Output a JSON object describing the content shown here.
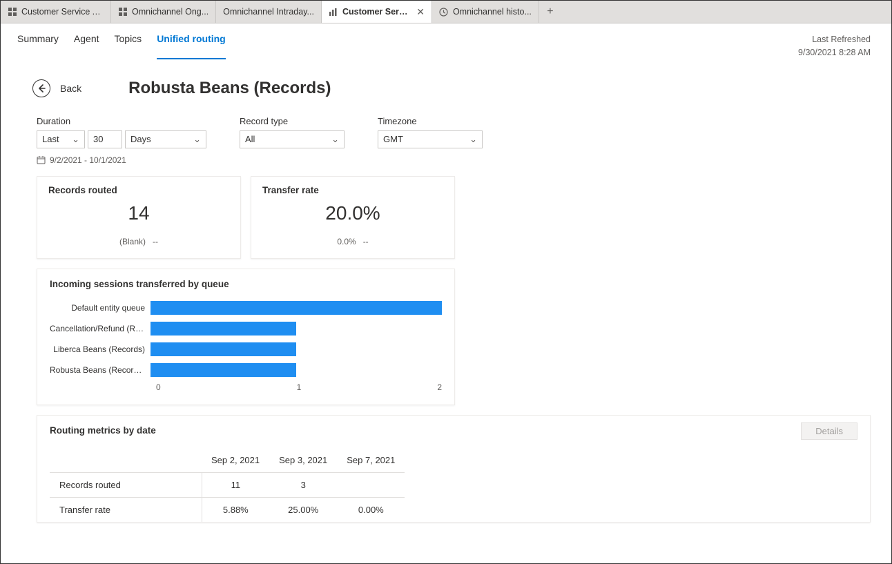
{
  "tabs": [
    {
      "label": "Customer Service A...",
      "active": false,
      "closable": false,
      "icon": "grid"
    },
    {
      "label": "Omnichannel Ong...",
      "active": false,
      "closable": false,
      "icon": "grid"
    },
    {
      "label": "Omnichannel Intraday...",
      "active": false,
      "closable": false,
      "icon": "none"
    },
    {
      "label": "Customer Service historic...",
      "active": true,
      "closable": true,
      "icon": "report"
    },
    {
      "label": "Omnichannel histo...",
      "active": false,
      "closable": false,
      "icon": "clock"
    }
  ],
  "subnav": {
    "items": [
      "Summary",
      "Agent",
      "Topics",
      "Unified routing"
    ],
    "active_index": 3
  },
  "refresh": {
    "label": "Last Refreshed",
    "value": "9/30/2021 8:28 AM"
  },
  "back_label": "Back",
  "page_title": "Robusta Beans (Records)",
  "filters": {
    "duration": {
      "label": "Duration",
      "last": "Last",
      "num": "30",
      "unit": "Days"
    },
    "record_type": {
      "label": "Record type",
      "value": "All"
    },
    "timezone": {
      "label": "Timezone",
      "value": "GMT"
    },
    "date_range": "9/2/2021 - 10/1/2021"
  },
  "kpi": {
    "records_routed": {
      "title": "Records routed",
      "value": "14",
      "sub_label": "(Blank)",
      "sub_value": "--"
    },
    "transfer_rate": {
      "title": "Transfer rate",
      "value": "20.0%",
      "sub_label": "0.0%",
      "sub_value": "--"
    }
  },
  "chart_data": {
    "type": "bar",
    "title": "Incoming sessions transferred by queue",
    "orientation": "horizontal",
    "categories": [
      "Default entity queue",
      "Cancellation/Refund (Rec...",
      "Liberca Beans (Records)",
      "Robusta Beans (Records)"
    ],
    "values": [
      2,
      1,
      1,
      1
    ],
    "xlim": [
      0,
      2
    ],
    "x_ticks": [
      0,
      1,
      2
    ],
    "xlabel": "",
    "ylabel": ""
  },
  "metrics_table": {
    "title": "Routing metrics by date",
    "details_label": "Details",
    "columns": [
      "Sep 2, 2021",
      "Sep 3, 2021",
      "Sep 7, 2021"
    ],
    "rows": [
      {
        "label": "Records routed",
        "values": [
          "11",
          "3",
          ""
        ]
      },
      {
        "label": "Transfer rate",
        "values": [
          "5.88%",
          "25.00%",
          "0.00%"
        ]
      }
    ]
  }
}
